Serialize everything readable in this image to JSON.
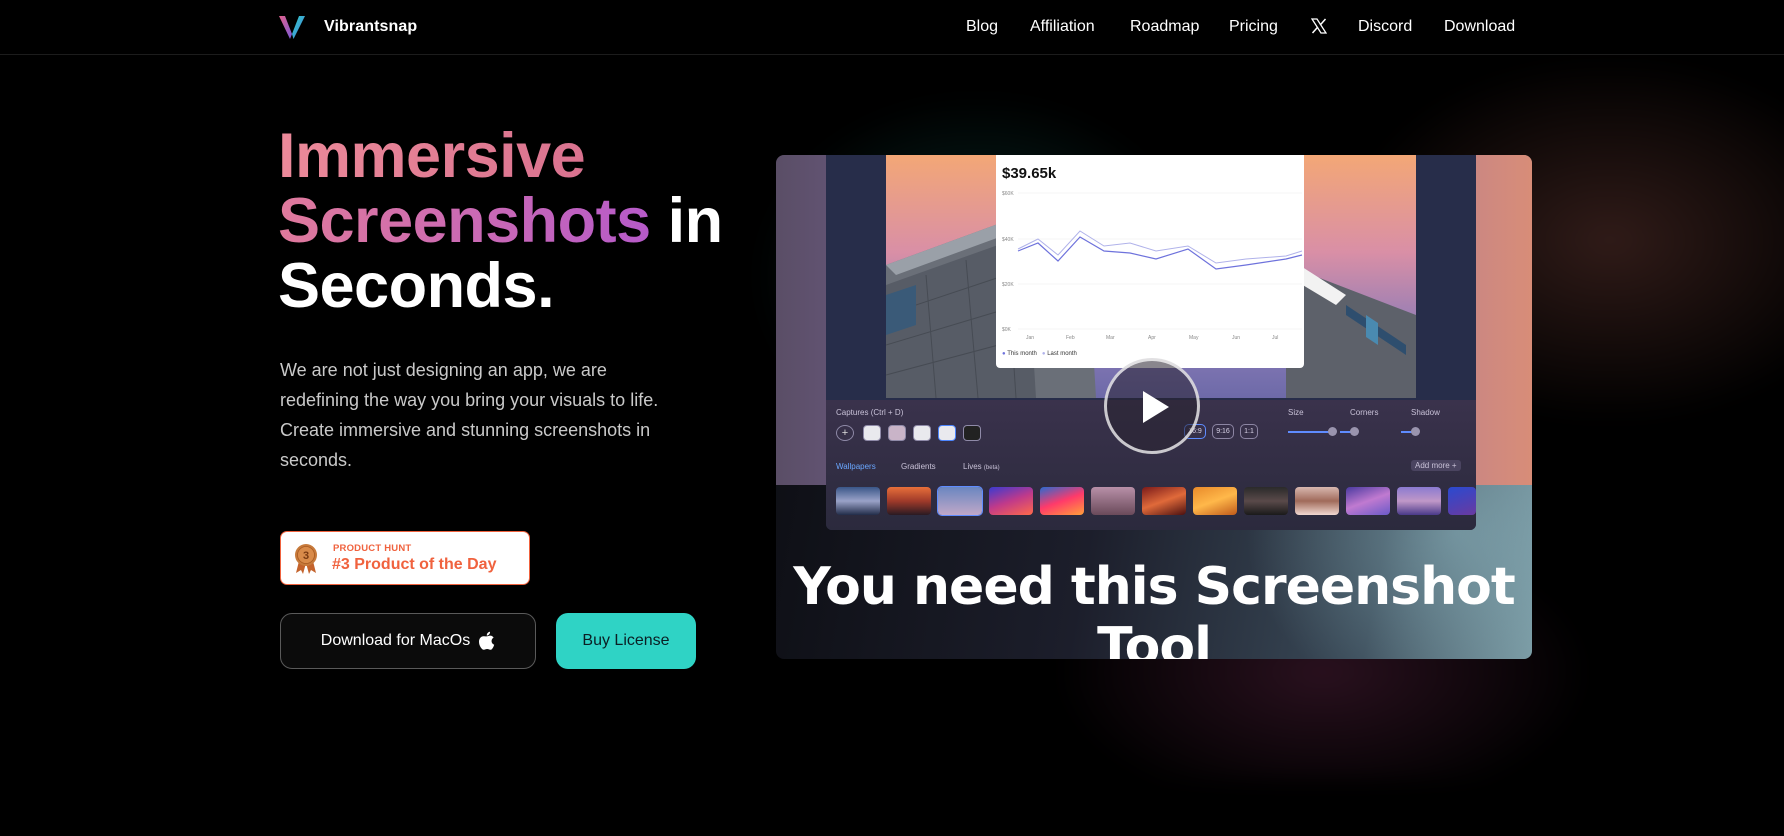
{
  "brand": {
    "name": "Vibrantsnap"
  },
  "nav": {
    "items": [
      "Blog",
      "Affiliation",
      "Roadmap",
      "Pricing",
      "Discord",
      "Download"
    ],
    "x_icon": "x-logo-icon"
  },
  "hero": {
    "title_line1": "Immersive",
    "title_line2_grad": "Screenshots",
    "title_line2_rest": " in",
    "title_line3": "Seconds.",
    "description": "We are not just designing an app, we are redefining the way you bring your visuals to life. Create immersive and stunning screenshots in seconds."
  },
  "badge": {
    "small": "PRODUCT HUNT",
    "big": "#3 Product of the Day",
    "rank": "3"
  },
  "buttons": {
    "download": "Download for MacOs",
    "buy": "Buy License"
  },
  "video": {
    "tagline": "You need this Screenshot Tool",
    "chart_value": "$39.65k",
    "chart_yticks": [
      "$60K",
      "$40K",
      "$20K",
      "$0K"
    ],
    "chart_months": [
      "Jan",
      "Feb",
      "Mar",
      "Apr",
      "May",
      "Jun",
      "Jul"
    ],
    "legend_this": "This month",
    "legend_last": "Last month",
    "toolbar": {
      "captures": "Captures",
      "captures_hint": "(Ctrl + D)",
      "size": "Size",
      "corners": "Corners",
      "shadow": "Shadow",
      "ratios": [
        "16:9",
        "9:16",
        "1:1"
      ],
      "wallpapers": "Wallpapers",
      "gradients": "Gradients",
      "lives": "Lives",
      "lives_tag": "(beta)",
      "add_more": "Add more +"
    }
  },
  "colors": {
    "accent": "#2fd3c5",
    "ph_orange": "#f0623e"
  }
}
